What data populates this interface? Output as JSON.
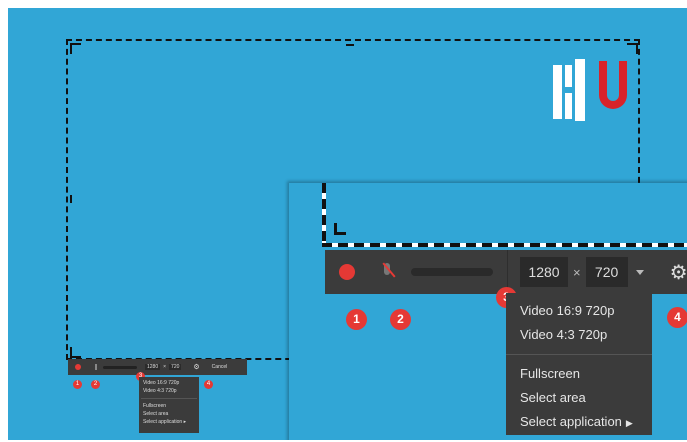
{
  "toolbar": {
    "width": "1280",
    "times": "×",
    "height": "720",
    "cancel_label": "Cancel"
  },
  "menu": {
    "items": [
      {
        "label": "Video 16:9 720p"
      },
      {
        "label": "Video 4:3 720p"
      },
      {
        "label": "Fullscreen"
      },
      {
        "label": "Select area"
      },
      {
        "label": "Select application"
      }
    ]
  },
  "badges": [
    "1",
    "2",
    "3",
    "4"
  ],
  "icons": {
    "record": "record-icon",
    "microphone": "microphone-muted-icon",
    "dropdown": "chevron-down-icon",
    "settings": "gear-icon",
    "submenu": "chevron-right-icon"
  },
  "colors": {
    "background": "#31a6d6",
    "toolbar": "#3b3b3b",
    "accent_red": "#e53935",
    "logo_red": "#d8232a"
  }
}
